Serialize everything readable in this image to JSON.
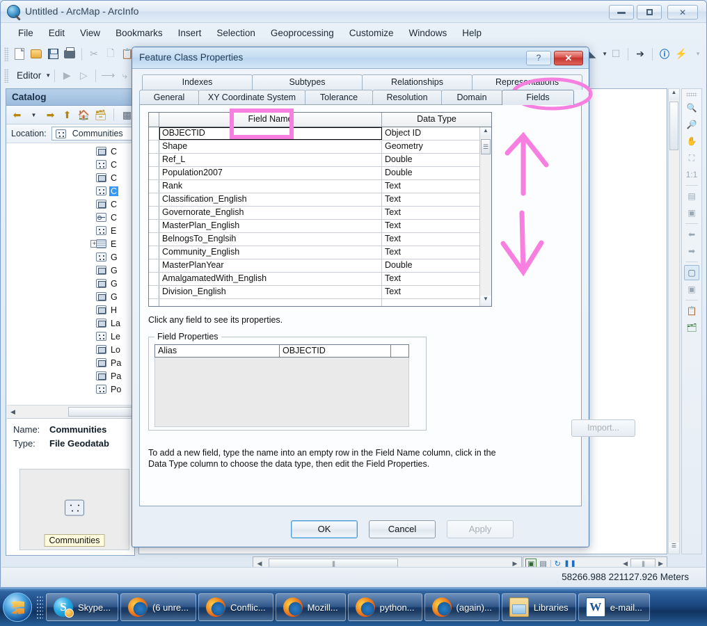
{
  "window": {
    "title": "Untitled - ArcMap - ArcInfo",
    "app_icon": "arcmap-globe-icon",
    "minimize": "minimize-icon",
    "maximize": "maximize-icon",
    "close": "close-icon"
  },
  "menubar": {
    "items": [
      "File",
      "Edit",
      "View",
      "Bookmarks",
      "Insert",
      "Selection",
      "Geoprocessing",
      "Customize",
      "Windows",
      "Help"
    ]
  },
  "toolbar": {
    "standard_icons": [
      "new-document-icon",
      "open-folder-icon",
      "save-icon",
      "print-icon",
      "cut-icon",
      "copy-icon",
      "paste-icon"
    ],
    "right_icons": [
      "select-features-icon",
      "chevron-down-icon",
      "clear-selection-icon",
      "select-elements-icon",
      "identify-icon",
      "flash-icon"
    ],
    "editor_label": "Editor",
    "editor_icons": [
      "edit-tool-icon",
      "edit-annotation-icon",
      "straight-segment-icon",
      "curve-segment-icon"
    ]
  },
  "catalog": {
    "title": "Catalog",
    "toolbar_icons": [
      "back-arrow-icon",
      "chevron-down-icon",
      "forward-arrow-icon",
      "up-one-level-icon",
      "home-icon",
      "default-geodatabase-icon",
      "contents-list-icon"
    ],
    "location_label": "Location:",
    "location_value": "Communities",
    "location_icon": "feature-class-point-icon",
    "tree_items": [
      {
        "label": "C",
        "icon": "feature-class-polygon-icon",
        "selected": false,
        "expandable": false
      },
      {
        "label": "C",
        "icon": "feature-class-point-icon",
        "selected": false,
        "expandable": false
      },
      {
        "label": "C",
        "icon": "feature-class-polygon-icon",
        "selected": false,
        "expandable": false
      },
      {
        "label": "C",
        "icon": "feature-class-point-icon",
        "selected": true,
        "expandable": false
      },
      {
        "label": "C",
        "icon": "feature-class-polygon-icon",
        "selected": false,
        "expandable": false
      },
      {
        "label": "C",
        "icon": "feature-class-line-icon",
        "selected": false,
        "expandable": false
      },
      {
        "label": "E",
        "icon": "feature-class-point-icon",
        "selected": false,
        "expandable": false
      },
      {
        "label": "E",
        "icon": "raster-dataset-icon",
        "selected": false,
        "expandable": true
      },
      {
        "label": "G",
        "icon": "feature-class-point-icon",
        "selected": false,
        "expandable": false
      },
      {
        "label": "G",
        "icon": "feature-class-polygon-icon",
        "selected": false,
        "expandable": false
      },
      {
        "label": "G",
        "icon": "feature-class-polygon-icon",
        "selected": false,
        "expandable": false
      },
      {
        "label": "G",
        "icon": "feature-class-polygon-icon",
        "selected": false,
        "expandable": false
      },
      {
        "label": "H",
        "icon": "feature-class-polygon-icon",
        "selected": false,
        "expandable": false
      },
      {
        "label": "La",
        "icon": "feature-class-polygon-icon",
        "selected": false,
        "expandable": false
      },
      {
        "label": "Le",
        "icon": "feature-class-point-icon",
        "selected": false,
        "expandable": false
      },
      {
        "label": "Lo",
        "icon": "feature-class-polygon-icon",
        "selected": false,
        "expandable": false
      },
      {
        "label": "Pa",
        "icon": "feature-class-polygon-icon",
        "selected": false,
        "expandable": false
      },
      {
        "label": "Pa",
        "icon": "feature-class-polygon-icon",
        "selected": false,
        "expandable": false
      },
      {
        "label": "Po",
        "icon": "feature-class-point-icon",
        "selected": false,
        "expandable": false
      }
    ],
    "info": {
      "name_label": "Name:",
      "name_value": "Communities",
      "type_label": "Type:",
      "type_value": "File Geodatab",
      "preview_icon": "feature-class-point-icon",
      "preview_label": "Communities"
    }
  },
  "dialog": {
    "title": "Feature Class Properties",
    "help_glyph": "?",
    "close_glyph": "✕",
    "tabs_top": [
      "Indexes",
      "Subtypes",
      "Relationships",
      "Representations"
    ],
    "tabs_bottom": [
      "General",
      "XY Coordinate System",
      "Tolerance",
      "Resolution",
      "Domain",
      "Fields"
    ],
    "active_tab": "Fields",
    "grid": {
      "headers": [
        "",
        "Field Name",
        "Data Type"
      ],
      "rows": [
        {
          "name": "OBJECTID",
          "type": "Object ID",
          "current": true
        },
        {
          "name": "Shape",
          "type": "Geometry",
          "current": false
        },
        {
          "name": "Ref_L",
          "type": "Double",
          "current": false
        },
        {
          "name": "Population2007",
          "type": "Double",
          "current": false
        },
        {
          "name": "Rank",
          "type": "Text",
          "current": false
        },
        {
          "name": "Classification_English",
          "type": "Text",
          "current": false
        },
        {
          "name": "Governorate_English",
          "type": "Text",
          "current": false
        },
        {
          "name": "MasterPlan_English",
          "type": "Text",
          "current": false
        },
        {
          "name": "BelnogsTo_Englsih",
          "type": "Text",
          "current": false
        },
        {
          "name": "Community_English",
          "type": "Text",
          "current": false
        },
        {
          "name": "MasterPlanYear",
          "type": "Double",
          "current": false
        },
        {
          "name": "AmalgamatedWith_English",
          "type": "Text",
          "current": false
        },
        {
          "name": "Division_English",
          "type": "Text",
          "current": false
        },
        {
          "name": "",
          "type": "",
          "current": false
        }
      ],
      "scroll_up_icon": "scroll-up-arrow-icon",
      "scroll_down_icon": "scroll-down-arrow-icon"
    },
    "hint_top": "Click any field to see its properties.",
    "field_properties": {
      "legend": "Field Properties",
      "alias_key": "Alias",
      "alias_value": "OBJECTID"
    },
    "import_label": "Import...",
    "hint_bottom": "To add a new field, type the name into an empty row in the Field Name column, click in the Data Type column to choose the data type, then edit the Field Properties.",
    "buttons": {
      "ok": "OK",
      "cancel": "Cancel",
      "apply": "Apply"
    }
  },
  "annotations": {
    "color": "#f77fe0",
    "shapes": [
      "rectangle-around-field-name-header",
      "ellipse-around-fields-tab",
      "up-arrow",
      "down-arrow"
    ]
  },
  "statusbar": {
    "coordinates": "58266.988  221127.926 Meters"
  },
  "right_toolbar": {
    "icons": [
      "zoom-in-icon",
      "zoom-out-icon",
      "pan-icon",
      "full-extent-icon",
      "fixed-zoom-icon",
      "previous-extent-icon",
      "next-extent-icon",
      "back-icon",
      "forward-icon",
      "select-elements-icon",
      "clear-selection-icon",
      "copy-icon",
      "layers-icon"
    ]
  },
  "toc_bar": {
    "icons": [
      "list-by-drawing-order-icon",
      "list-by-source-icon",
      "refresh-icon",
      "pause-icon"
    ]
  },
  "taskbar": {
    "start_icon": "windows-start-orb-icon",
    "items": [
      {
        "label": "Skype...",
        "icon": "skype-icon"
      },
      {
        "label": "(6 unre...",
        "icon": "firefox-icon"
      },
      {
        "label": "Conflic...",
        "icon": "firefox-icon"
      },
      {
        "label": "Mozill...",
        "icon": "firefox-icon"
      },
      {
        "label": "python...",
        "icon": "firefox-icon"
      },
      {
        "label": "(again)...",
        "icon": "firefox-icon"
      },
      {
        "label": "Libraries",
        "icon": "windows-explorer-icon"
      },
      {
        "label": "e-mail...",
        "icon": "word-icon"
      }
    ]
  }
}
